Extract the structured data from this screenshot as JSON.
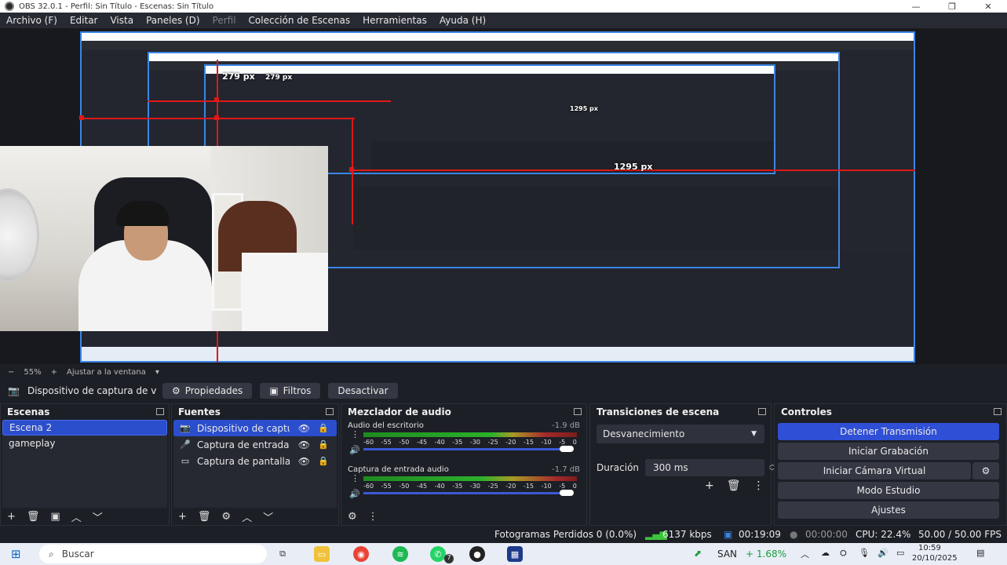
{
  "window": {
    "title": "OBS 32.0.1 - Perfil: Sin Título - Escenas: Sin Título",
    "minimize": "—",
    "maximize": "❐",
    "close": "✕"
  },
  "menu": {
    "items": [
      "Archivo (F)",
      "Editar",
      "Vista",
      "Paneles (D)",
      "Perfil",
      "Colección de Escenas",
      "Herramientas",
      "Ayuda (H)"
    ]
  },
  "preview": {
    "px_label_top": "279 px",
    "px_label_top2": "279 px",
    "px_label_bottom": "1295 px",
    "px_label_bottom2": "1295 px"
  },
  "zoom": {
    "minus": "−",
    "value": "55%",
    "plus": "+",
    "fit": "Ajustar a la ventana",
    "dropdown_icon": "caret-down-icon"
  },
  "source_toolbar": {
    "source_name": "Dispositivo de captura de v",
    "properties": "Propiedades",
    "filters": "Filtros",
    "deactivate": "Desactivar"
  },
  "scenes": {
    "title": "Escenas",
    "items": [
      "Escena 2",
      "gameplay"
    ]
  },
  "sources": {
    "title": "Fuentes",
    "items": [
      {
        "label": "Dispositivo de captu",
        "icon": "camera-icon"
      },
      {
        "label": "Captura de entrada",
        "icon": "microphone-icon"
      },
      {
        "label": "Captura de pantalla",
        "icon": "monitor-icon"
      }
    ]
  },
  "mixer": {
    "title": "Mezclador de audio",
    "channels": [
      {
        "name": "Audio del escritorio",
        "db": "-1.9 dB"
      },
      {
        "name": "Captura de entrada audio",
        "db": "-1.7 dB"
      }
    ],
    "ticks": [
      "-60",
      "-55",
      "-50",
      "-45",
      "-40",
      "-35",
      "-30",
      "-25",
      "-20",
      "-15",
      "-10",
      "-5",
      "0"
    ]
  },
  "transitions": {
    "title": "Transiciones de escena",
    "selected": "Desvanecimiento",
    "duration_label": "Duración",
    "duration_value": "300 ms"
  },
  "controls": {
    "title": "Controles",
    "stop_stream": "Detener Transmisión",
    "start_record": "Iniciar Grabación",
    "virtual_cam": "Iniciar Cámara Virtual",
    "studio_mode": "Modo Estudio",
    "settings": "Ajustes"
  },
  "status": {
    "frames_dropped": "Fotogramas Perdidos 0 (0.0%)",
    "bitrate": "6137 kbps",
    "stream_time": "00:19:09",
    "record_time": "00:00:00",
    "cpu": "CPU: 22.4%",
    "fps": "50.00 / 50.00 FPS"
  },
  "taskbar": {
    "search_placeholder": "Buscar",
    "ticker_name": "SAN",
    "ticker_change": "+ 1.68%",
    "time": "10:59",
    "date": "20/10/2025",
    "whatsapp_badge": "7"
  },
  "colors": {
    "accent": "#2f4fd6",
    "selection": "#2b4ecc",
    "preview_border": "#3b86e6",
    "guide_red": "#e01818"
  }
}
